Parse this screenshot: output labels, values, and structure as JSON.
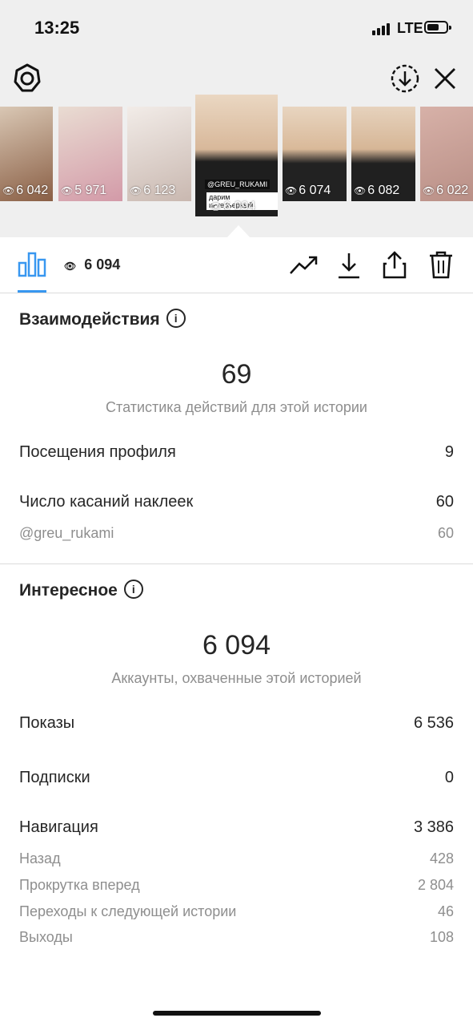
{
  "status_bar": {
    "time": "13:25",
    "network": "LTE"
  },
  "stories": [
    {
      "views": "6 042",
      "colors": [
        "#d9c7b4",
        "#8a5f45"
      ]
    },
    {
      "views": "5 971",
      "colors": [
        "#e9dcd2",
        "#d39aa8"
      ]
    },
    {
      "views": "6 123",
      "colors": [
        "#f2ece8",
        "#c9b8b0"
      ]
    },
    {
      "views": "6 094",
      "colors": [
        "#ead7c2",
        "#1e1e1e"
      ],
      "caption": "дарим интерьерный",
      "mention": "@GREU_RUKAMI"
    },
    {
      "views": "6 074",
      "colors": [
        "#e8d5c0",
        "#222222"
      ]
    },
    {
      "views": "6 082",
      "colors": [
        "#e6d2bd",
        "#202020"
      ]
    },
    {
      "views": "6 022",
      "colors": [
        "#d7b1a8",
        "#b98f86"
      ]
    }
  ],
  "toolbar": {
    "reach_value": "6 094"
  },
  "interactions": {
    "title": "Взаимодействия",
    "total": "69",
    "subtitle": "Статистика действий для этой истории",
    "rows": [
      {
        "label": "Посещения профиля",
        "value": "9"
      },
      {
        "label": "Число касаний наклеек",
        "value": "60"
      }
    ],
    "sticker_row": {
      "label": "@greu_rukami",
      "value": "60"
    }
  },
  "discovery": {
    "title": "Интересное",
    "total": "6 094",
    "subtitle": "Аккаунты, охваченные этой историей",
    "rows": [
      {
        "label": "Показы",
        "value": "6 536"
      },
      {
        "label": "Подписки",
        "value": "0"
      },
      {
        "label": "Навигация",
        "value": "3 386"
      }
    ],
    "nav_rows": [
      {
        "label": "Назад",
        "value": "428"
      },
      {
        "label": "Прокрутка вперед",
        "value": "2 804"
      },
      {
        "label": "Переходы к следующей истории",
        "value": "46"
      },
      {
        "label": "Выходы",
        "value": "108"
      }
    ]
  }
}
